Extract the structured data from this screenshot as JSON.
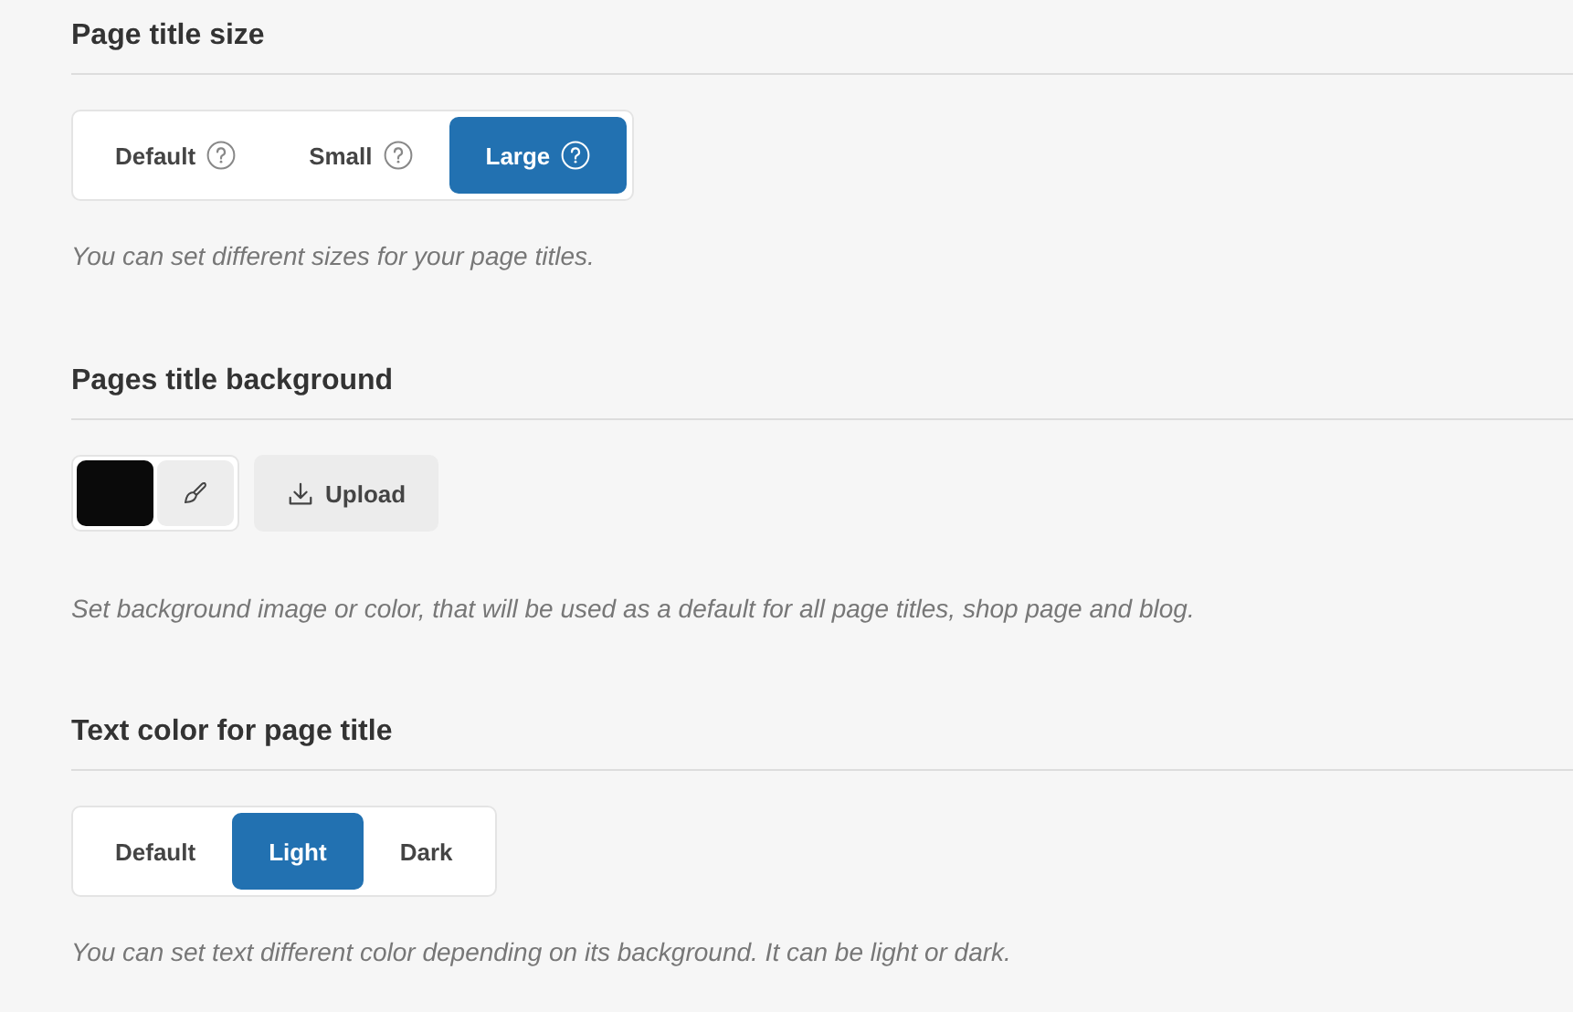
{
  "sections": [
    {
      "kind": "segmented",
      "title": "Page title size",
      "options": [
        {
          "label": "Default",
          "help": true,
          "selected": false
        },
        {
          "label": "Small",
          "help": true,
          "selected": false
        },
        {
          "label": "Large",
          "help": true,
          "selected": true
        }
      ],
      "hint": "You can set different sizes for your page titles."
    },
    {
      "kind": "background",
      "title": "Pages title background",
      "color": "#0a0a0a",
      "upload": "Upload",
      "hint": "Set background image or color, that will be used as a default for all page titles, shop page and blog."
    },
    {
      "kind": "segmented",
      "title": "Text color for page title",
      "options": [
        {
          "label": "Default",
          "help": false,
          "selected": false
        },
        {
          "label": "Light",
          "help": false,
          "selected": true
        },
        {
          "label": "Dark",
          "help": false,
          "selected": false
        }
      ],
      "hint": "You can set text different color depending on its background. It can be light or dark."
    }
  ]
}
